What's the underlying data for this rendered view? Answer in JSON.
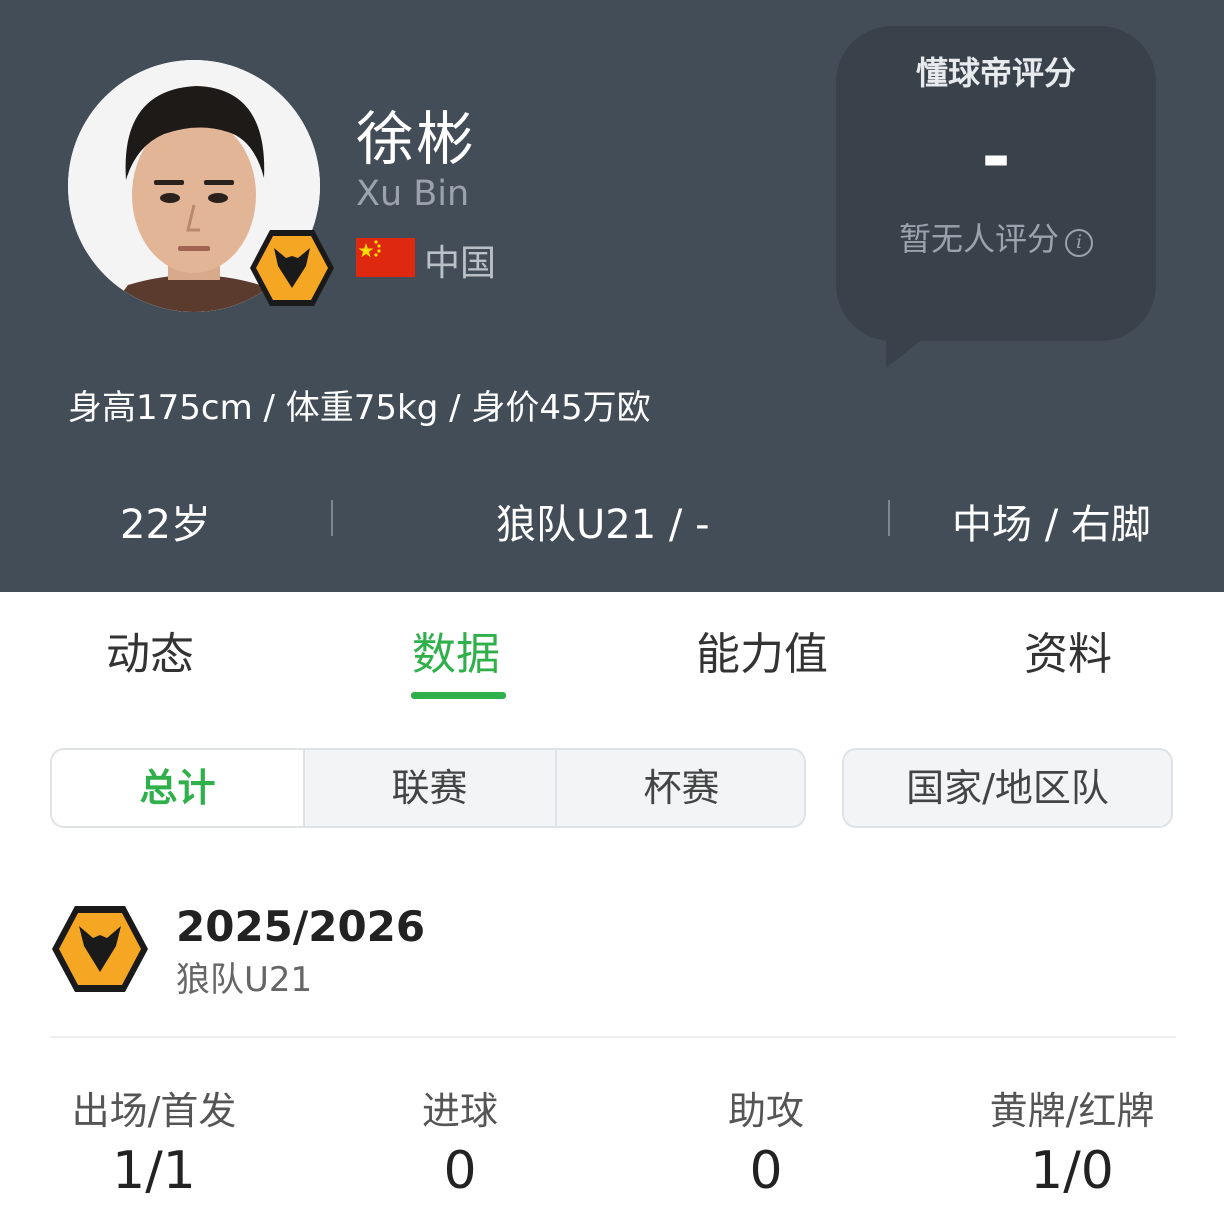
{
  "player": {
    "name_cn": "徐彬",
    "name_en": "Xu Bin",
    "country": "中国",
    "body_info": "身高175cm / 体重75kg / 身价45万欧",
    "age": "22岁",
    "club_number": "狼队U21 / -",
    "position_foot": "中场 / 右脚"
  },
  "rating": {
    "title": "懂球帝评分",
    "value": "-",
    "note": "暂无人评分"
  },
  "tabs": [
    {
      "label": "动态",
      "active": false
    },
    {
      "label": "数据",
      "active": true
    },
    {
      "label": "能力值",
      "active": false
    },
    {
      "label": "资料",
      "active": false
    }
  ],
  "filters": {
    "segments": [
      "总计",
      "联赛",
      "杯赛"
    ],
    "active_segment": "总计",
    "national": "国家/地区队"
  },
  "season": {
    "year": "2025/2026",
    "team": "狼队U21",
    "stats": [
      {
        "label": "出场/首发",
        "value": "1/1"
      },
      {
        "label": "进球",
        "value": "0"
      },
      {
        "label": "助攻",
        "value": "0"
      },
      {
        "label": "黄牌/红牌",
        "value": "1/0"
      }
    ]
  },
  "colors": {
    "header_bg": "#434d57",
    "accent_green": "#2fb04a",
    "badge_orange": "#f5a623"
  },
  "icons": {
    "club_badge": "wolves-crest-icon",
    "flag": "china-flag-icon",
    "info": "info-icon"
  }
}
